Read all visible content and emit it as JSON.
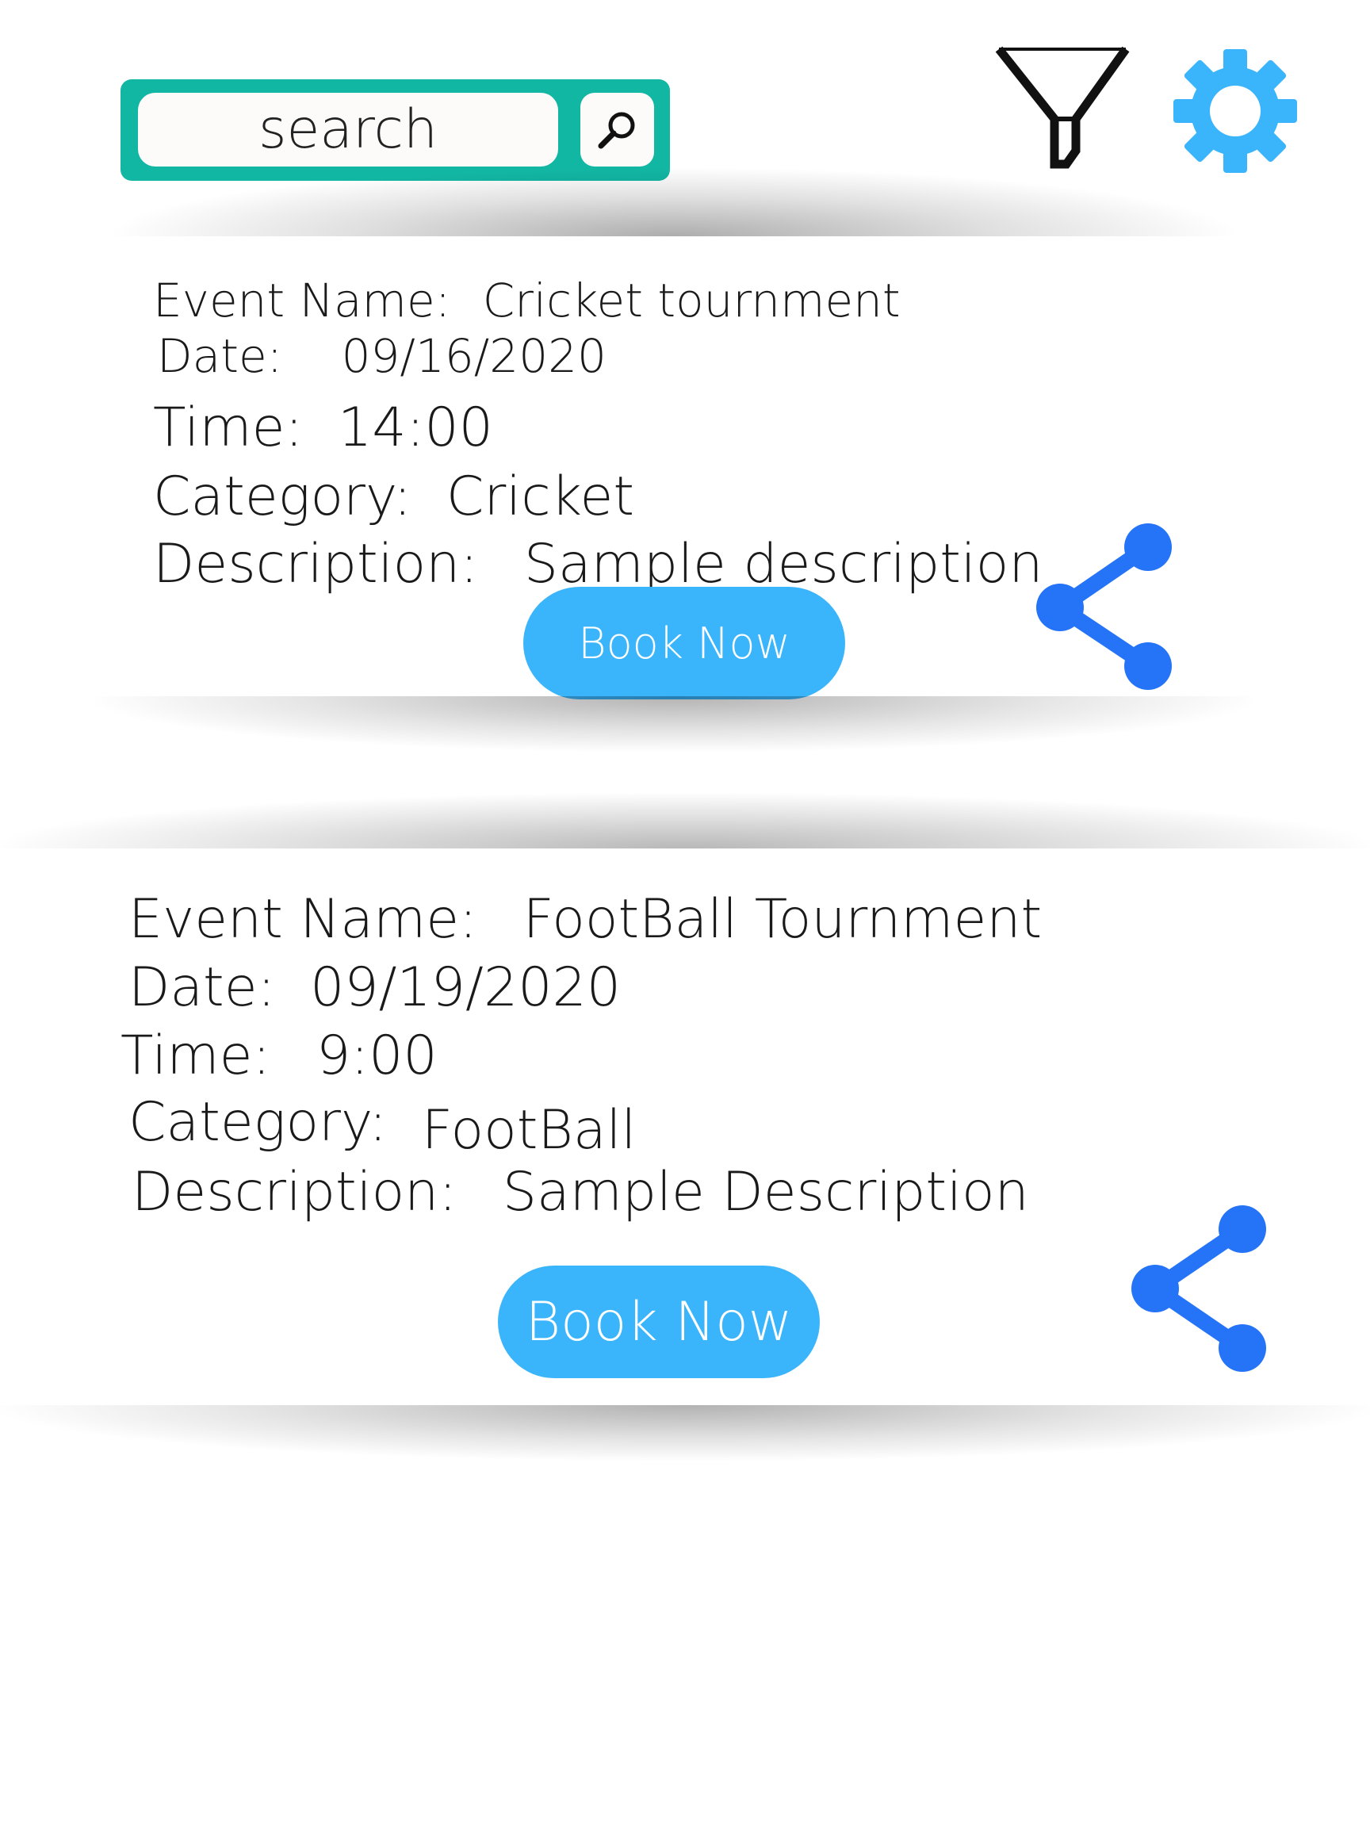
{
  "search": {
    "placeholder": "search",
    "icon": "magnifier-icon"
  },
  "toolbar": {
    "filter_icon": "filter-funnel-icon",
    "settings_icon": "gear-icon"
  },
  "colors": {
    "search_bar": "#12b7a4",
    "button": "#3ab4fb",
    "share_icon": "#2574f7",
    "gear_icon": "#3ab4fb"
  },
  "events": [
    {
      "event_name_label": "Event Name:",
      "event_name": "Cricket tournment",
      "date_label": "Date:",
      "date": "09/16/2020",
      "time_label": "Time:",
      "time": "14:00",
      "category_label": "Category:",
      "category": "Cricket",
      "description_label": "Description:",
      "description": "Sample description",
      "book_label": "Book Now",
      "share_icon": "share-icon"
    },
    {
      "event_name_label": "Event Name:",
      "event_name": "FootBall Tournment",
      "date_label": "Date:",
      "date": "09/19/2020",
      "time_label": "Time:",
      "time": "9:00",
      "category_label": "Category:",
      "category": "FootBall",
      "description_label": "Description:",
      "description": "Sample Description",
      "book_label": "Book Now",
      "share_icon": "share-icon"
    }
  ]
}
